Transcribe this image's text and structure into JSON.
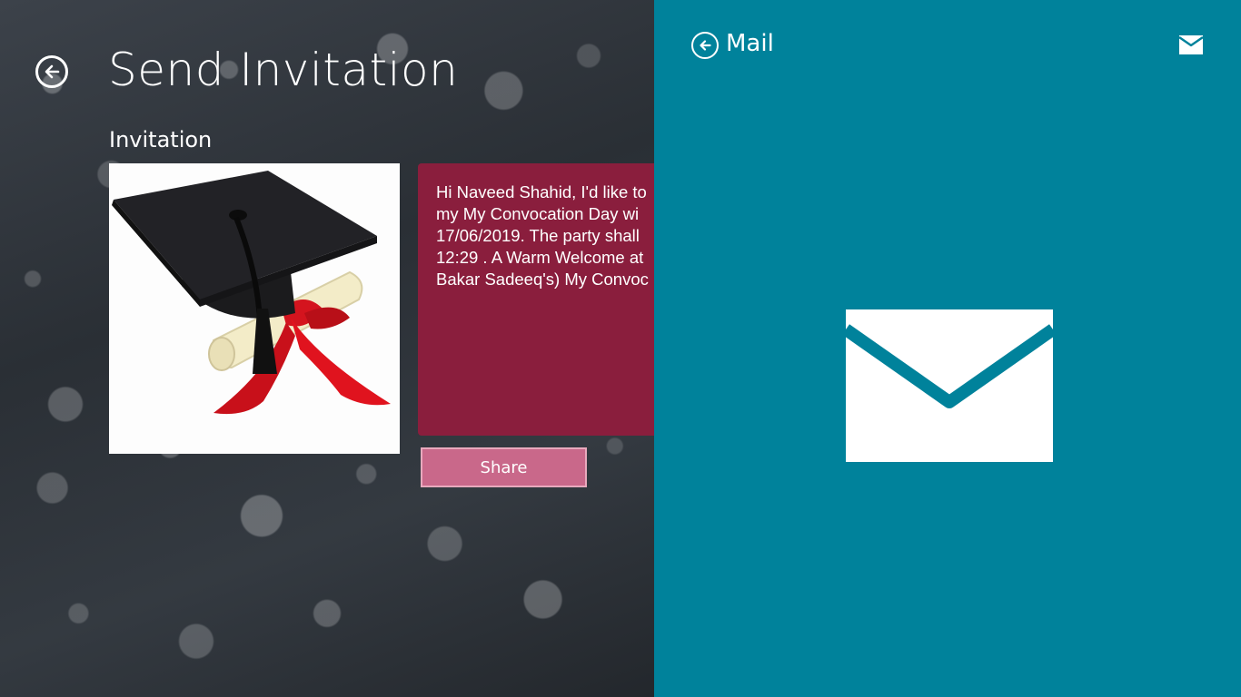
{
  "app": {
    "page_title": "Send Invitation",
    "section_label": "Invitation",
    "message": "Hi Naveed Shahid, I'd like to\nmy My Convocation Day wi\n17/06/2019. The party shall\n12:29 . A Warm Welcome at\nBakar Sadeeq's) My Convoc",
    "share_label": "Share"
  },
  "share_pane": {
    "title": "Mail"
  },
  "icons": {
    "back": "back-arrow-icon",
    "mail": "mail-icon",
    "invite_image": "graduation-cap-diploma-image"
  },
  "colors": {
    "pane_bg": "#00829b",
    "message_bg": "#8a1e3d",
    "share_button": "#c9688a"
  }
}
